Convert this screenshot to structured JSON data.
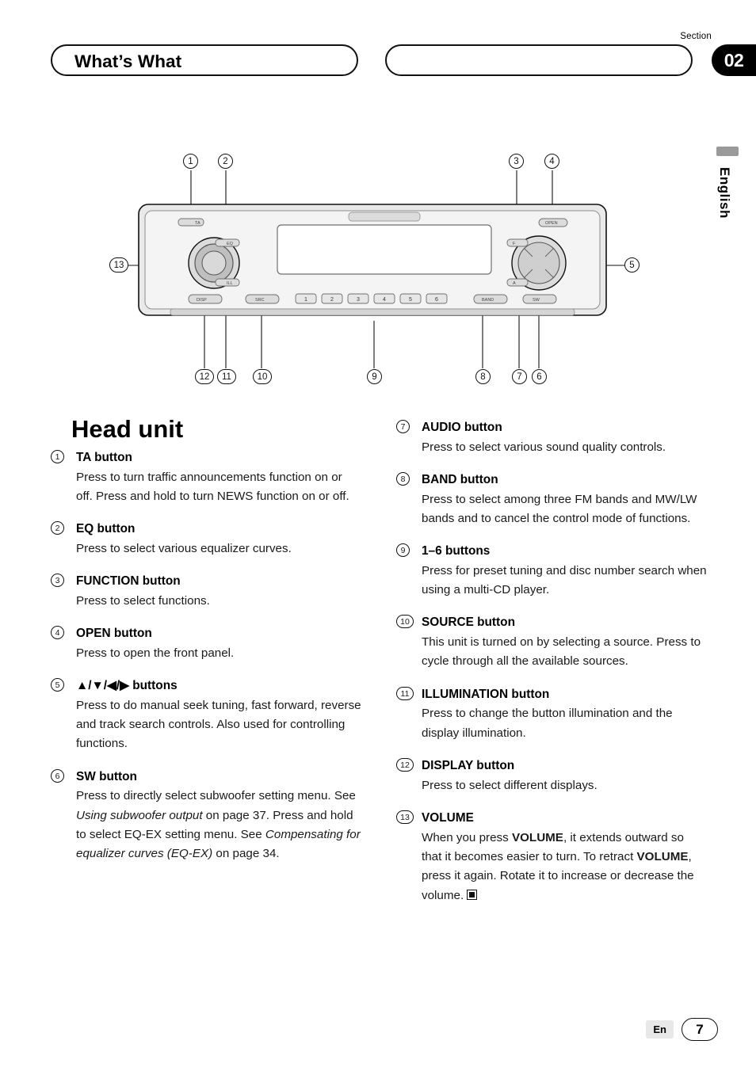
{
  "header": {
    "title": "What’s What",
    "section_label": "Section",
    "section_number": "02"
  },
  "side_tab": {
    "language": "English"
  },
  "diagram": {
    "callouts": [
      "1",
      "2",
      "3",
      "4",
      "5",
      "6",
      "7",
      "8",
      "9",
      "10",
      "11",
      "12",
      "13"
    ],
    "preset_buttons": [
      "1",
      "2",
      "3",
      "4",
      "5",
      "6"
    ],
    "labels": {
      "ta": "TA",
      "eq": "EQ",
      "illumination": "ILL",
      "display": "DISP",
      "source": "SRC",
      "open": "OPEN",
      "function": "F",
      "audio": "A",
      "band": "BAND",
      "sw": "SW"
    }
  },
  "body": {
    "title": "Head unit",
    "left_entries": [
      {
        "num": "1",
        "head": "TA button",
        "desc": "Press to turn traffic announcements function on or off. Press and hold to turn NEWS function on or off."
      },
      {
        "num": "2",
        "head": "EQ button",
        "desc": "Press to select various equalizer curves."
      },
      {
        "num": "3",
        "head": "FUNCTION button",
        "desc": "Press to select functions."
      },
      {
        "num": "4",
        "head": "OPEN button",
        "desc": "Press to open the front panel."
      },
      {
        "num": "5",
        "head": "▲/▼/◀/▶ buttons",
        "desc": "Press to do manual seek tuning, fast forward, reverse and track search controls. Also used for controlling functions."
      },
      {
        "num": "6",
        "head": "SW button",
        "desc_part1": "Press to directly select subwoofer setting menu. See ",
        "desc_italic1": "Using subwoofer output",
        "desc_part2": " on page 37.  Press and hold to select EQ-EX setting menu. See ",
        "desc_italic2": "Compensating for equalizer curves (EQ-EX)",
        "desc_part3": " on page 34."
      }
    ],
    "right_entries": [
      {
        "num": "7",
        "head": "AUDIO button",
        "desc": "Press to select various sound quality controls."
      },
      {
        "num": "8",
        "head": "BAND button",
        "desc": "Press to select among three FM bands and MW/LW bands and to cancel the control mode of functions."
      },
      {
        "num": "9",
        "head": "1–6 buttons",
        "desc": "Press for preset tuning and disc number search when using a multi-CD player."
      },
      {
        "num": "10",
        "head": "SOURCE button",
        "desc": "This unit is turned on by selecting a source. Press to cycle through all the available sources."
      },
      {
        "num": "11",
        "head": "ILLUMINATION button",
        "desc": "Press to change the button illumination and the display illumination."
      },
      {
        "num": "12",
        "head": "DISPLAY button",
        "desc": "Press to select different displays."
      },
      {
        "num": "13",
        "head": "VOLUME",
        "desc_part1": "When you press ",
        "desc_bold1": "VOLUME",
        "desc_part2": ", it extends outward so that it becomes easier to turn. To retract ",
        "desc_bold2": "VOLUME",
        "desc_part3": ", press it again. Rotate it to increase or decrease the volume."
      }
    ]
  },
  "footer": {
    "language_code": "En",
    "page_number": "7"
  }
}
